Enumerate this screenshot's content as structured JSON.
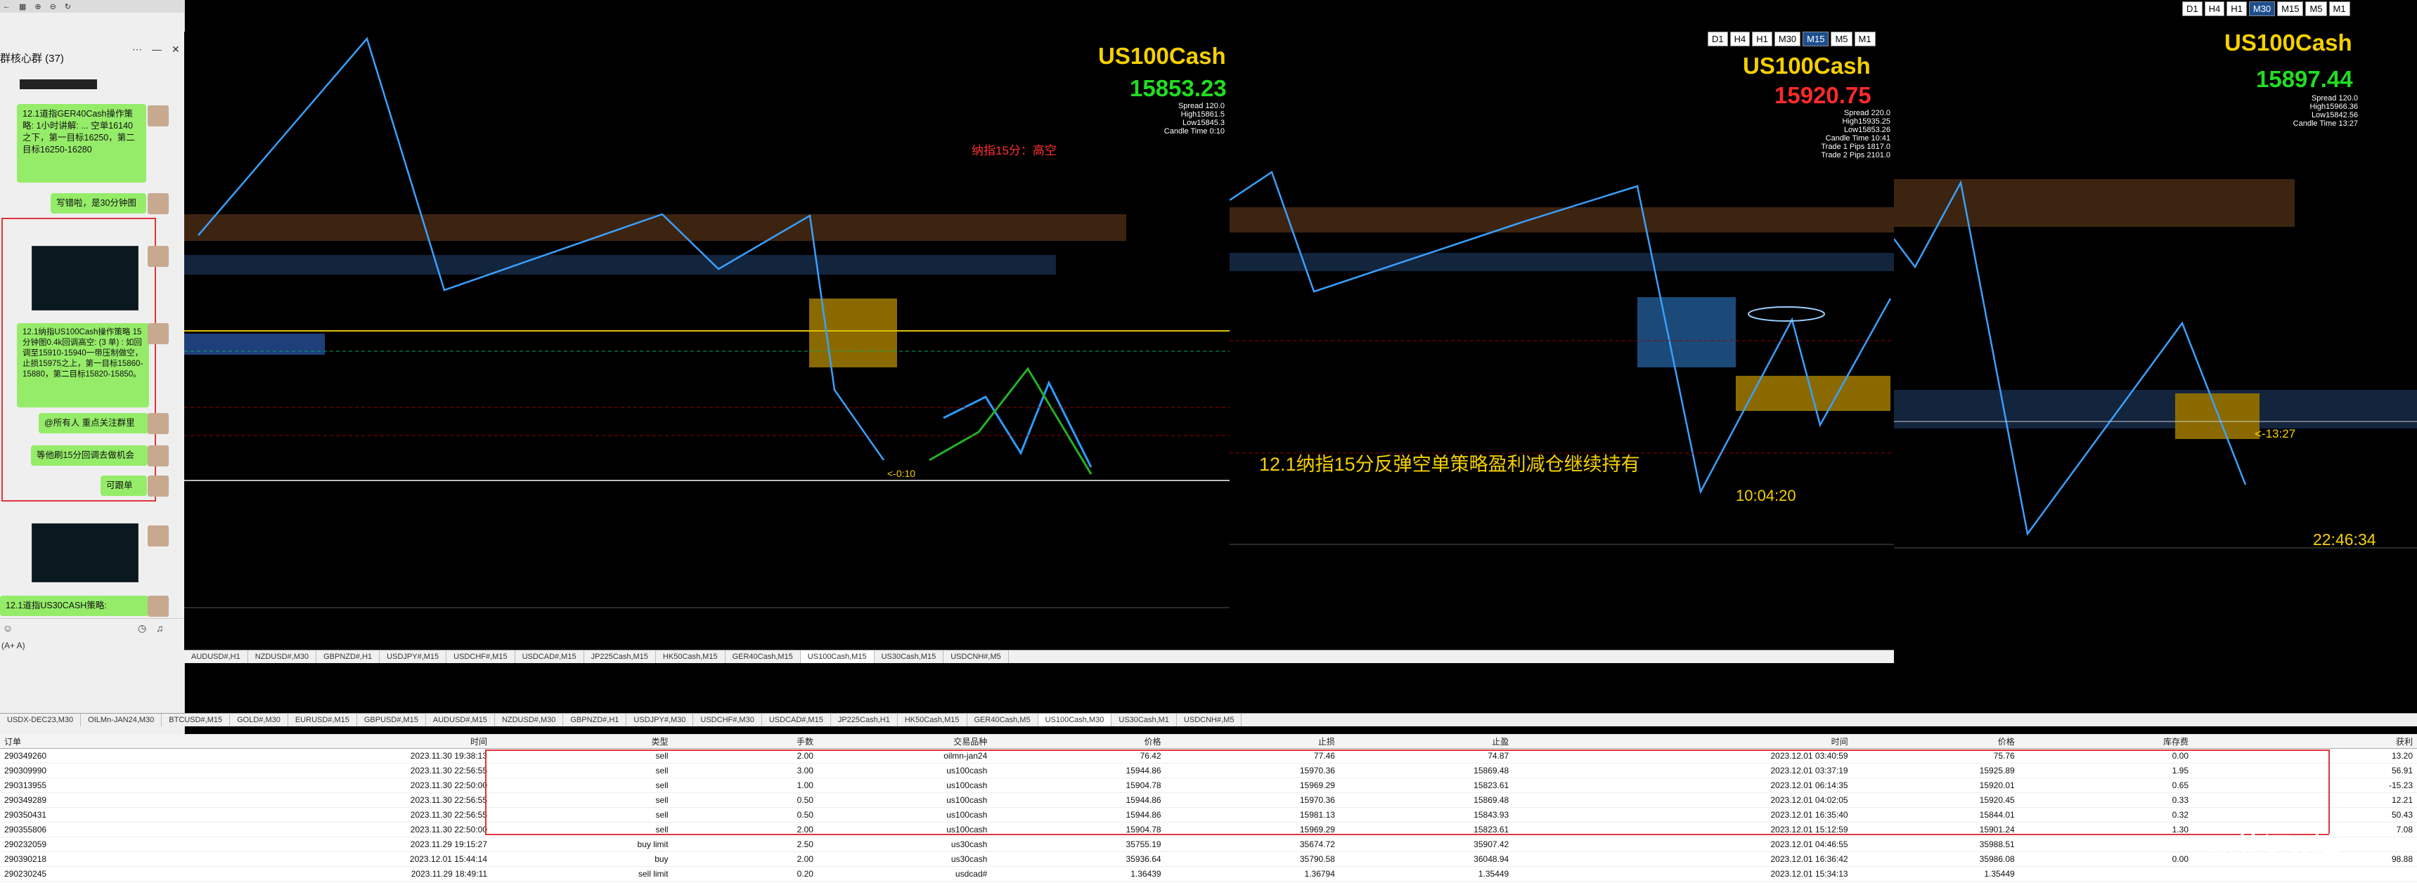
{
  "chat": {
    "title": "群核心群 (37)",
    "messages": [
      {
        "text": "12.1道指GER40Cash操作策略: 1小时讲解: ... 空单16140之下，第一目标16250，第二目标16250-16280"
      },
      {
        "text": "写错啦，是30分钟图"
      },
      {
        "text": "12.1纳指US100Cash操作策略 15分钟图0.4k回调高空: (3 单) : 如回调至15910-15940一带压制做空，止损15975之上，第一目标15860-15880，第二目标15820-15850。"
      },
      {
        "text": "@所有人 重点关注群里"
      },
      {
        "text": "等他刷15分回调去做机会"
      },
      {
        "text": "可跟单"
      },
      {
        "text": "12.1道指US30CASH策略:"
      }
    ],
    "input_hint": "(A+ A)"
  },
  "charts": [
    {
      "symbol": "US100Cash",
      "price": "15853.23",
      "price_color": "#22dd22",
      "info": [
        "Spread 120.0",
        "High15861.5",
        "Low15845.3",
        "Candle Time 0:10"
      ],
      "note": "纳指15分：高空",
      "timer": "<-0:10",
      "pair": "US100Cash,M15"
    },
    {
      "symbol": "US100Cash",
      "price": "15920.75",
      "price_color": "#ff2a2a",
      "info": [
        "Spread 220.0",
        "High15935.25",
        "Low15853.26",
        "Candle Time 10:41",
        "Trade 1 Pips 1817.0",
        "Trade 2 Pips 2101.0"
      ],
      "caption": "12.1纳指15分反弹空单策略盈利减仓继续持有",
      "clock": "10:04:20",
      "timeframes": [
        "D1",
        "H4",
        "H1",
        "M30",
        "M15",
        "M5",
        "M1"
      ],
      "active_tf": "M15"
    },
    {
      "symbol": "US100Cash",
      "price": "15897.44",
      "price_color": "#22dd22",
      "info": [
        "Spread 120.0",
        "High15966.36",
        "Low15842.56",
        "Candle Time 13:27"
      ],
      "timer": "<-13:27",
      "clock": "22:46:34",
      "timeframes": [
        "D1",
        "H4",
        "H1",
        "M30",
        "M15",
        "M5",
        "M1"
      ],
      "active_tf": "M30"
    }
  ],
  "mid_tabs": [
    "AUDUSD#,H1",
    "NZDUSD#,M30",
    "GBPNZD#,H1",
    "USDJPY#,M15",
    "USDCHF#,M15",
    "USDCAD#,M15",
    "JP225Cash,M15",
    "HK50Cash,M15",
    "GER40Cash,M15",
    "US100Cash,M15",
    "US30Cash,M15",
    "USDCNH#,M5"
  ],
  "mid_active": "US100Cash,M15",
  "bottom_tabs": [
    "USDX-DEC23,M30",
    "OILMn-JAN24,M30",
    "BTCUSD#,M15",
    "GOLD#,M30",
    "EURUSD#,M15",
    "GBPUSD#,M15",
    "AUDUSD#,M15",
    "NZDUSD#,M30",
    "GBPNZD#,H1",
    "USDJPY#,M30",
    "USDCHF#,M30",
    "USDCAD#,M15",
    "JP225Cash,H1",
    "HK50Cash,M15",
    "GER40Cash,M5",
    "US100Cash,M30",
    "US30Cash,M1",
    "USDCNH#,M5"
  ],
  "bottom_active": "US100Cash,M30",
  "terminal": {
    "headers": [
      "订单",
      "时间",
      "类型",
      "手数",
      "交易品种",
      "价格",
      "止损",
      "止盈",
      "时间",
      "价格",
      "库存费",
      "获利"
    ],
    "rows": [
      [
        "290349260",
        "2023.11.30 19:38:13",
        "sell",
        "2.00",
        "oilmn-jan24",
        "76.42",
        "77.46",
        "74.87",
        "2023.12.01 03:40:59",
        "75.76",
        "0.00",
        "13.20"
      ],
      [
        "290309990",
        "2023.11.30 22:56:55",
        "sell",
        "3.00",
        "us100cash",
        "15944.86",
        "15970.36",
        "15869.48",
        "2023.12.01 03:37:19",
        "15925.89",
        "1.95",
        "56.91"
      ],
      [
        "290313955",
        "2023.11.30 22:50:00",
        "sell",
        "1.00",
        "us100cash",
        "15904.78",
        "15969.29",
        "15823.61",
        "2023.12.01 06:14:35",
        "15920.01",
        "0.65",
        "-15.23"
      ],
      [
        "290349289",
        "2023.11.30 22:56:55",
        "sell",
        "0.50",
        "us100cash",
        "15944.86",
        "15970.36",
        "15869.48",
        "2023.12.01 04:02:05",
        "15920.45",
        "0.33",
        "12.21"
      ],
      [
        "290350431",
        "2023.11.30 22:56:55",
        "sell",
        "0.50",
        "us100cash",
        "15944.86",
        "15981.13",
        "15843.93",
        "2023.12.01 16:35:40",
        "15844.01",
        "0.32",
        "50.43"
      ],
      [
        "290355806",
        "2023.11.30 22:50:00",
        "sell",
        "2.00",
        "us100cash",
        "15904.78",
        "15969.29",
        "15823.61",
        "2023.12.01 15:12:59",
        "15901.24",
        "1.30",
        "7.08"
      ],
      [
        "290232059",
        "2023.11.29 19:15:27",
        "buy limit",
        "2.50",
        "us30cash",
        "35755.19",
        "35674.72",
        "35907.42",
        "2023.12.01 04:46:55",
        "35988.51",
        "",
        ""
      ],
      [
        "290390218",
        "2023.12.01 15:44:14",
        "buy",
        "2.00",
        "us30cash",
        "35936.64",
        "35790.58",
        "36048.94",
        "2023.12.01 16:36:42",
        "35986.08",
        "0.00",
        "98.88"
      ],
      [
        "290230245",
        "2023.11.29 18:49:11",
        "sell limit",
        "0.20",
        "usdcad#",
        "1.36439",
        "1.36794",
        "1.35449",
        "2023.12.01 15:34:13",
        "1.35449",
        "",
        ""
      ]
    ],
    "watermark": "@外汇K神"
  }
}
